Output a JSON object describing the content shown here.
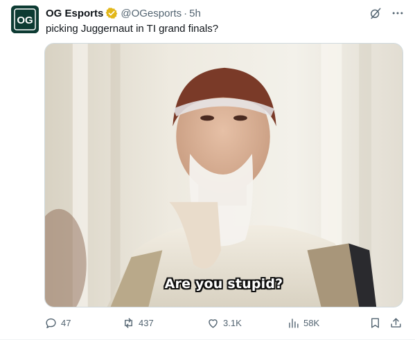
{
  "post": {
    "author_name": "OG Esports",
    "handle": "@OGesports",
    "separator": "·",
    "time": "5h",
    "text": "picking Juggernaut in TI grand finals?",
    "avatar_text": "OG",
    "media": {
      "caption": "Are you stupid?"
    },
    "actions": {
      "replies": "47",
      "reposts": "437",
      "likes": "3.1K",
      "views": "58K"
    }
  },
  "icons": {
    "verified": "verified-badge-icon",
    "grok": "grok-icon",
    "more": "more-icon",
    "reply": "reply-icon",
    "repost": "repost-icon",
    "like": "heart-icon",
    "views": "views-icon",
    "bookmark": "bookmark-icon",
    "share": "share-icon"
  },
  "colors": {
    "text_primary": "#0f1419",
    "text_secondary": "#536471",
    "verified_gold": "#e2b719",
    "avatar_bg": "#0d3b33"
  }
}
